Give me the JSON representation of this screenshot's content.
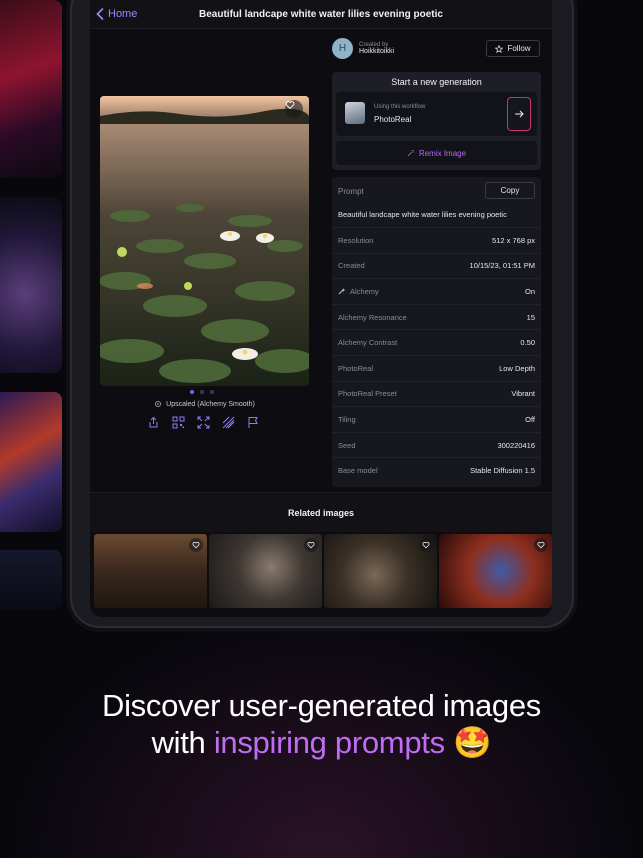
{
  "nav": {
    "back_label": "Home",
    "title": "Beautiful landcape white water lilies evening poetic"
  },
  "creator": {
    "avatar_letter": "H",
    "label": "Created by",
    "name": "Hoikkitoikki",
    "follow_label": "Follow"
  },
  "generation": {
    "title": "Start a new generation",
    "workflow_label": "Using this workflow",
    "workflow_name": "PhotoReal",
    "remix_label": "Remix Image"
  },
  "image": {
    "carousel_count": 3,
    "carousel_active": 1,
    "upscale_label": "Upscaled (Alchemy Smooth)"
  },
  "details": {
    "prompt_label": "Prompt",
    "copy_label": "Copy",
    "prompt": "Beautiful landcape white water lilies evening poetic",
    "rows": [
      {
        "key": "Resolution",
        "value": "512 x 768 px"
      },
      {
        "key": "Created",
        "value": "10/15/23, 01:51 PM"
      },
      {
        "key": "Alchemy",
        "value": "On",
        "icon": "alchemy-icon"
      },
      {
        "key": "Alchemy Resonance",
        "value": "15"
      },
      {
        "key": "Alchemy Contrast",
        "value": "0.50"
      },
      {
        "key": "PhotoReal",
        "value": "Low Depth"
      },
      {
        "key": "PhotoReal Preset",
        "value": "Vibrant"
      },
      {
        "key": "Tiling",
        "value": "Off"
      },
      {
        "key": "Seed",
        "value": "300220416"
      },
      {
        "key": "Base model",
        "value": "Stable Diffusion 1.5"
      }
    ]
  },
  "related": {
    "title": "Related images"
  },
  "tagline": {
    "line1": "Discover user-generated images",
    "line2_prefix": "with",
    "line2_accent": "inspiring prompts",
    "emoji": "🤩"
  },
  "colors": {
    "accent_purple": "#9b8bff",
    "remix_purple": "#b76cf0",
    "tagline_accent": "#c06cf5",
    "go_border": "#c2367a"
  }
}
